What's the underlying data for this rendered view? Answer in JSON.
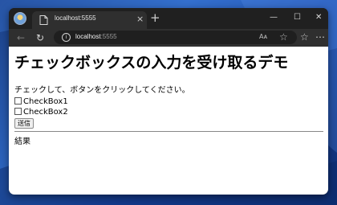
{
  "browser": {
    "tab": {
      "title": "localhost:5555",
      "close_icon": "×"
    },
    "new_tab_icon": "+",
    "window_controls": {
      "minimize": "—",
      "maximize": "☐",
      "close": "✕"
    },
    "nav": {
      "back": "←",
      "reload": "↻"
    },
    "address": {
      "host": "localhost",
      "port": ":5555",
      "info_icon": "i"
    },
    "toolbar_icons": {
      "read_aloud": "Á)",
      "favorite": "☆",
      "favorites": "☆",
      "more": "⋯"
    },
    "colors": {
      "frame": "#202020",
      "toolbar": "#2f2f2f",
      "desktop": "#2e68c4"
    }
  },
  "page": {
    "title": "チェックボックスの入力を受け取るデモ",
    "instruction": "チェックして、ボタンをクリックしてください。",
    "checkboxes": [
      {
        "label": "CheckBox1",
        "checked": false
      },
      {
        "label": "CheckBox2",
        "checked": false
      }
    ],
    "submit_label": "送信",
    "result_label": "結果"
  }
}
